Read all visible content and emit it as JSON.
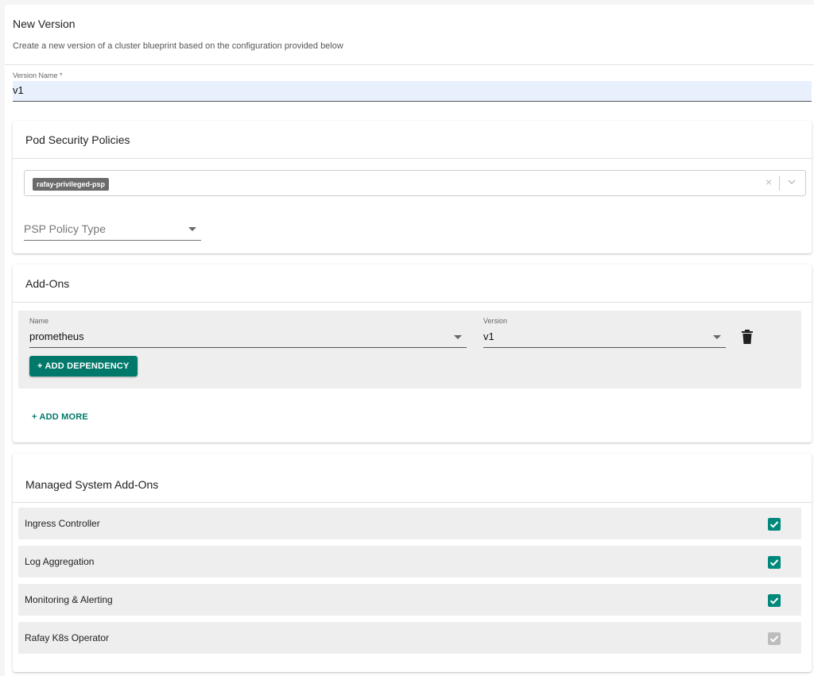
{
  "header": {
    "title": "New Version",
    "subtitle": "Create a new version of a cluster blueprint based on the configuration provided below"
  },
  "version_name": {
    "label": "Version Name *",
    "value": "v1"
  },
  "psp": {
    "title": "Pod Security Policies",
    "selected_chip": "rafay-privileged-psp",
    "clear_glyph": "×",
    "policy_type_placeholder": "PSP Policy Type"
  },
  "addons": {
    "title": "Add-Ons",
    "name_label": "Name",
    "name_value": "prometheus",
    "version_label": "Version",
    "version_value": "v1",
    "add_dependency_label": "+ ADD DEPENDENCY",
    "add_more_label": "+ ADD MORE"
  },
  "managed": {
    "title": "Managed System Add-Ons",
    "items": [
      {
        "label": "Ingress Controller",
        "checked": true,
        "disabled": false
      },
      {
        "label": "Log Aggregation",
        "checked": true,
        "disabled": false
      },
      {
        "label": "Monitoring & Alerting",
        "checked": true,
        "disabled": false
      },
      {
        "label": "Rafay K8s Operator",
        "checked": true,
        "disabled": true
      }
    ]
  },
  "colors": {
    "accent": "#00796b",
    "checkbox_enabled": "#00897b",
    "checkbox_disabled": "#bdbdbd",
    "field_highlight": "#e8f0fe"
  },
  "icons": {
    "trash": "trash-icon",
    "chevron": "chevron-down-icon",
    "clear": "close-icon",
    "check": "check-icon"
  }
}
